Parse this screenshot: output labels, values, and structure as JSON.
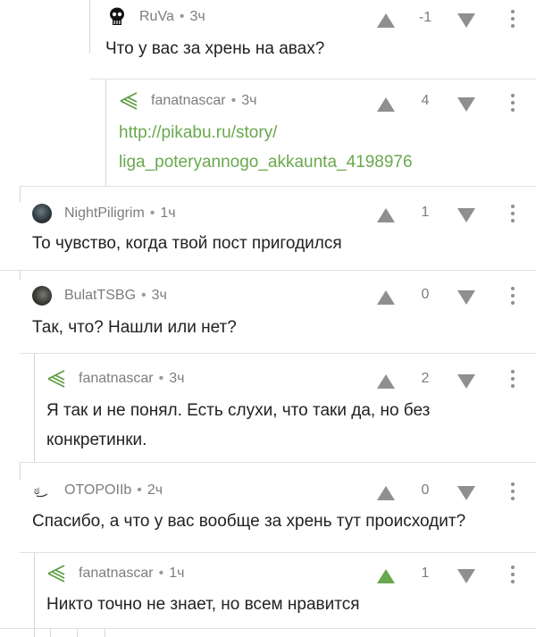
{
  "comments": [
    {
      "author": "RuVa",
      "separator": "•",
      "time": "3ч",
      "text": "Что у вас за хрень на авах?",
      "score": "-1",
      "avatar": "skull-avatar"
    },
    {
      "author": "fanatnascar",
      "separator": "•",
      "time": "3ч",
      "link_lines": [
        "http://pikabu.ru/story/",
        "liga_poteryannogo_akkaunta_4198976"
      ],
      "score": "4",
      "avatar": "pikabu-mark-avatar"
    },
    {
      "author": "NightPiligrim",
      "separator": "•",
      "time": "1ч",
      "text": "То чувство, когда твой пост пригодился",
      "score": "1",
      "avatar": "photo-avatar"
    },
    {
      "author": "BulatTSBG",
      "separator": "•",
      "time": "3ч",
      "text": "Так, что? Нашли или нет?",
      "score": "0",
      "avatar": "photo-avatar"
    },
    {
      "author": "fanatnascar",
      "separator": "•",
      "time": "3ч",
      "text_lines": [
        "Я так и не понял. Есть слухи, что таки да, но без",
        "конкретинки."
      ],
      "score": "2",
      "avatar": "pikabu-mark-avatar"
    },
    {
      "author": "OTOPOIIb",
      "separator": "•",
      "time": "2ч",
      "text": "Спасибо, а что у вас вообще за хрень тут происходит?",
      "score": "0",
      "avatar": "emoticon-avatar"
    },
    {
      "author": "fanatnascar",
      "separator": "•",
      "time": "1ч",
      "text": "Никто точно не знает, но всем нравится",
      "score": "1",
      "avatar": "pikabu-mark-avatar",
      "upvoted": true
    }
  ],
  "colors": {
    "vote_gray": "#8f8f8f",
    "vote_active": "#6aa84f",
    "link": "#6aa84f",
    "line": "#d6d6d6"
  },
  "icons": {
    "upvote": "triangle-up-icon",
    "downvote": "triangle-down-icon",
    "menu": "kebab-menu-icon"
  }
}
